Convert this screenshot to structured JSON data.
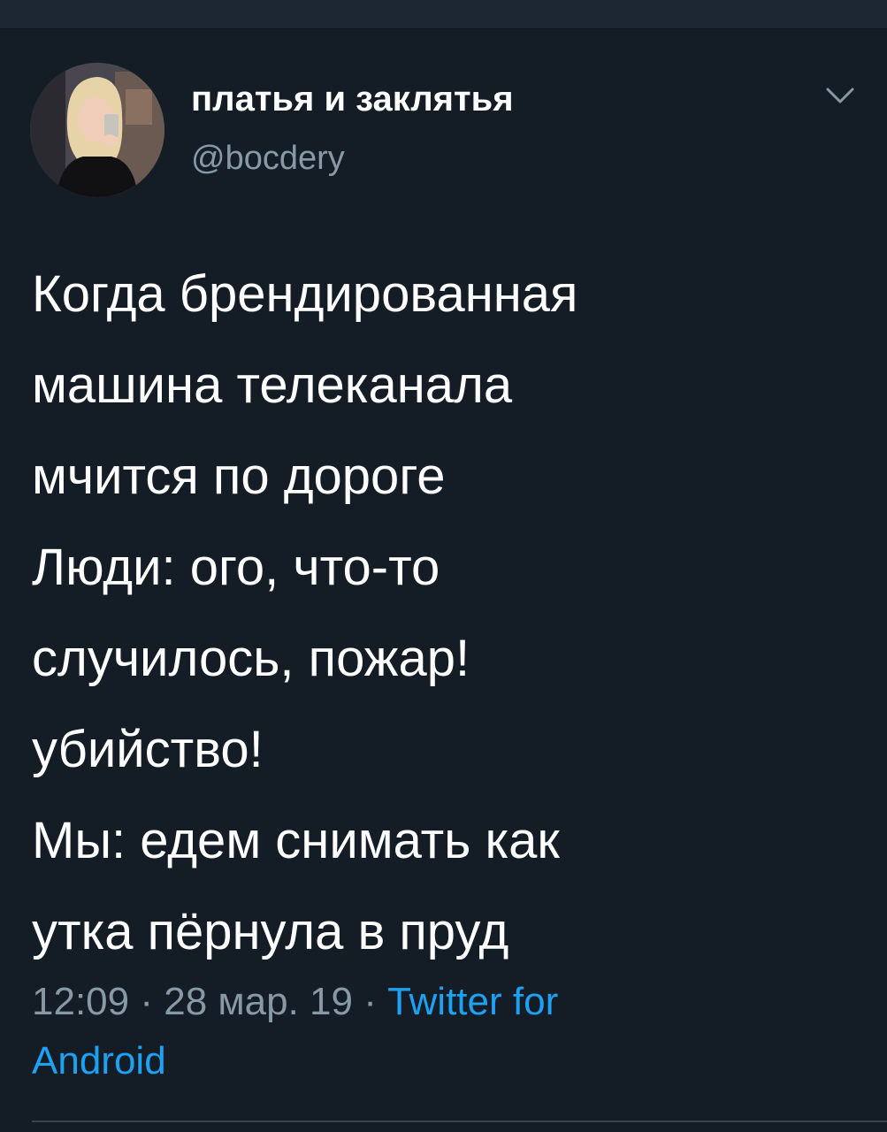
{
  "tweet": {
    "author": {
      "display_name": "платья и заклятья",
      "handle": "@bocdery",
      "avatar_icon": "user-photo-avatar"
    },
    "menu_icon": "chevron-down-icon",
    "text_lines": [
      "Когда брендированная",
      "машина телеканала",
      "мчится по дороге",
      "Люди: ого, что-то",
      "случилось, пожар!",
      "убийство!",
      "Мы: едем снимать как",
      "утка пёрнула в пруд"
    ],
    "meta": {
      "time": "12:09",
      "sep1": " · ",
      "date": "28 мар. 19",
      "sep2": " · ",
      "source_line1": "Twitter for",
      "source_line2": "Android"
    }
  },
  "colors": {
    "background": "#141d26",
    "text": "#ffffff",
    "secondary": "#8899a6",
    "link": "#1da1f2"
  }
}
